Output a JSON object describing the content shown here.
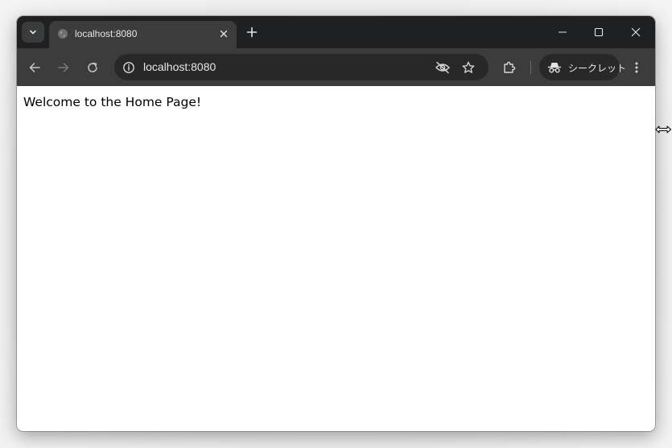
{
  "titlebar": {
    "tab_search_icon": "chevron-down-icon",
    "tab": {
      "favicon": "globe-icon",
      "title": "localhost:8080",
      "close_icon": "close-icon"
    },
    "new_tab_icon": "plus-icon",
    "window_controls": [
      "minimize-icon",
      "maximize-icon",
      "close-icon"
    ]
  },
  "toolbar": {
    "nav_icons": [
      "arrow-left-icon",
      "arrow-right-icon",
      "reload-icon"
    ],
    "omnibox": {
      "site_info_icon": "info-icon",
      "url": "localhost:8080",
      "icons": [
        "eye-off-icon",
        "star-icon"
      ]
    },
    "extensions_icon": "puzzle-icon",
    "incognito": {
      "icon": "incognito-icon",
      "label": "シークレット"
    },
    "menu_icon": "kebab-menu-icon"
  },
  "page": {
    "text": "Welcome to the Home Page!"
  },
  "colors": {
    "titlebar_bg": "#1f2022",
    "toolbar_bg": "#3c3c3c",
    "omnibox_bg": "#282828",
    "page_bg": "#ffffff"
  }
}
